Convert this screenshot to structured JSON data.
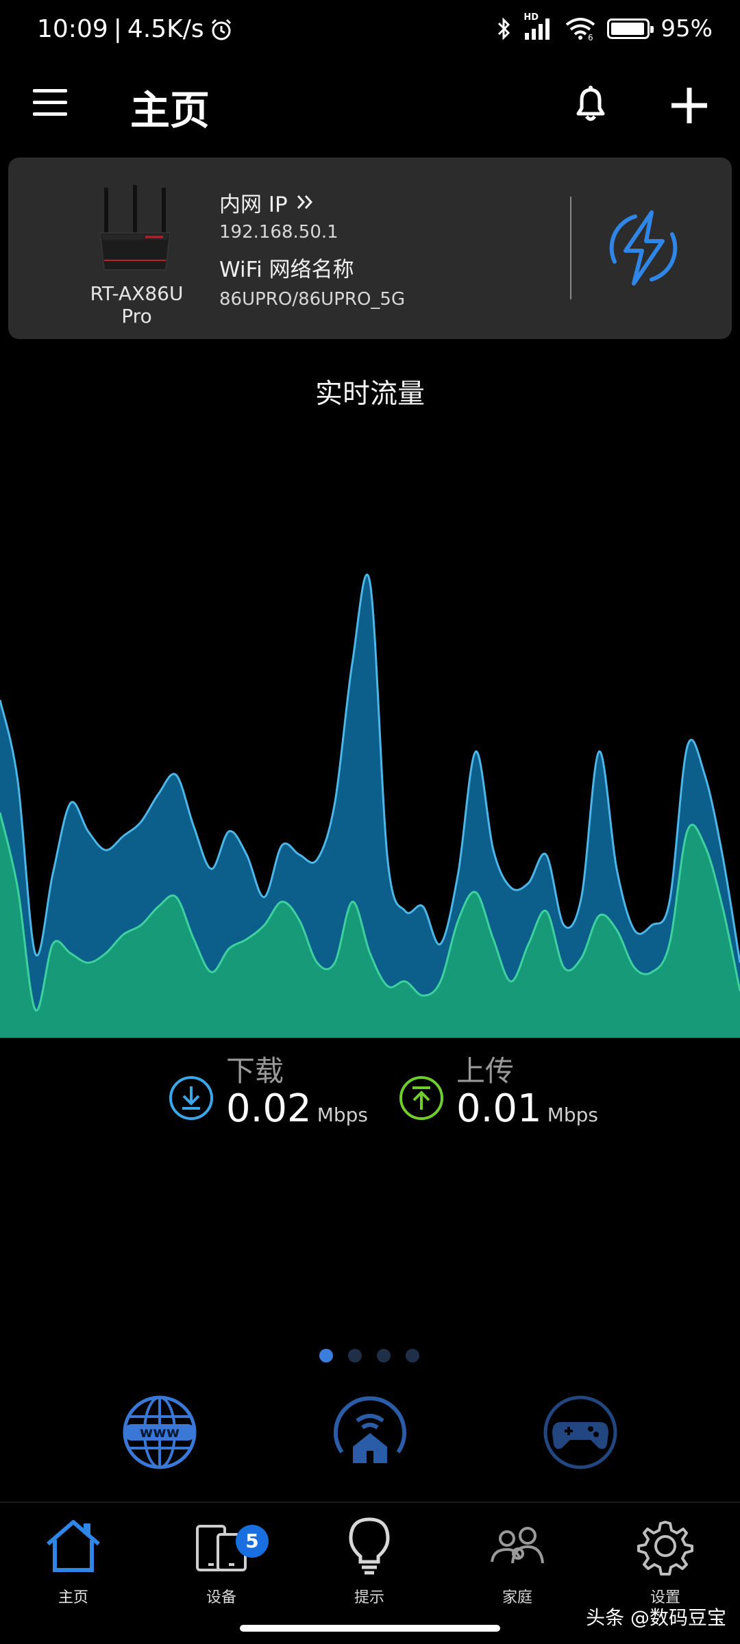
{
  "status_bar": {
    "time": "10:09",
    "separator": "|",
    "net_speed": "4.5K/s",
    "signal_tag": "HD",
    "battery": "95%",
    "battery_level": 0.95
  },
  "header": {
    "title": "主页"
  },
  "router_card": {
    "model": "RT-AX86U Pro",
    "lan_ip_label": "内网 IP",
    "lan_ip_value": "192.168.50.1",
    "wifi_label": "WiFi 网络名称",
    "wifi_value": "86UPRO/86UPRO_5G"
  },
  "traffic": {
    "title": "实时流量",
    "download_label": "下载",
    "download_value": "0.02",
    "download_unit": "Mbps",
    "upload_label": "上传",
    "upload_value": "0.01",
    "upload_unit": "Mbps",
    "colors": {
      "download": "#0b5f8a",
      "download_line": "#4fb6e8",
      "upload": "#179a78",
      "upload_line": "#3fd0a0"
    }
  },
  "chart_data": {
    "type": "area",
    "x": [
      0,
      1,
      2,
      3,
      4,
      5,
      6,
      7,
      8,
      9,
      10,
      11,
      12,
      13,
      14,
      15,
      16,
      17,
      18,
      19,
      20,
      21,
      22,
      23,
      24,
      25,
      26,
      27,
      28,
      29,
      30,
      31,
      32,
      33,
      34,
      35,
      36,
      37,
      38,
      39,
      40,
      41,
      42,
      43,
      44,
      45,
      46,
      47,
      48
    ],
    "series": [
      {
        "values": [
          0.72,
          0.55,
          0.18,
          0.35,
          0.5,
          0.44,
          0.4,
          0.43,
          0.46,
          0.52,
          0.56,
          0.45,
          0.36,
          0.44,
          0.39,
          0.3,
          0.41,
          0.39,
          0.38,
          0.5,
          0.8,
          0.97,
          0.38,
          0.27,
          0.28,
          0.2,
          0.35,
          0.61,
          0.4,
          0.32,
          0.33,
          0.39,
          0.24,
          0.3,
          0.61,
          0.36,
          0.23,
          0.24,
          0.29,
          0.62,
          0.56,
          0.39,
          0.16
        ]
      },
      {
        "values": [
          0.48,
          0.32,
          0.06,
          0.2,
          0.18,
          0.16,
          0.18,
          0.22,
          0.24,
          0.28,
          0.3,
          0.21,
          0.14,
          0.19,
          0.21,
          0.24,
          0.29,
          0.25,
          0.16,
          0.16,
          0.29,
          0.18,
          0.11,
          0.12,
          0.09,
          0.12,
          0.25,
          0.31,
          0.21,
          0.12,
          0.2,
          0.27,
          0.15,
          0.17,
          0.26,
          0.23,
          0.15,
          0.14,
          0.2,
          0.44,
          0.41,
          0.28,
          0.1
        ]
      }
    ],
    "ylim": [
      0,
      1
    ]
  },
  "pager": {
    "count": 4,
    "active": 0
  },
  "quick_actions": [
    {
      "name": "www-icon"
    },
    {
      "name": "smart-home-icon"
    },
    {
      "name": "gamepad-icon"
    }
  ],
  "bottom_nav": {
    "items": [
      {
        "label": "主页"
      },
      {
        "label": "设备",
        "badge": "5"
      },
      {
        "label": "提示"
      },
      {
        "label": "家庭"
      },
      {
        "label": "设置"
      }
    ]
  },
  "watermark": "头条 @数码豆宝"
}
